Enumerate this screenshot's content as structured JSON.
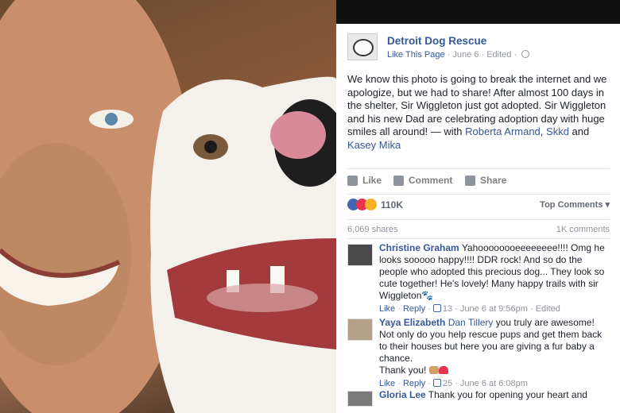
{
  "post": {
    "page_name": "Detroit Dog Rescue",
    "like_page": "Like This Page",
    "date": "June 6",
    "edited": "Edited",
    "text_main": "We know this photo is going to break the internet and we apologize, but we had to share! After almost 100 days in the shelter, Sir Wiggleton just got adopted. Sir Wiggleton and his new Dad are celebrating adoption day with huge smiles all around! — with ",
    "tag1": "Roberta Armand",
    "tag_sep1": ", ",
    "tag2": "Skkd",
    "tag_sep2": " and ",
    "tag3": "Kasey Mika"
  },
  "actions": {
    "like": "Like",
    "comment": "Comment",
    "share": "Share"
  },
  "reactions": {
    "count": "110K",
    "top_comments": "Top Comments ▾"
  },
  "stats": {
    "shares": "6,069 shares",
    "comments": "1K comments"
  },
  "comments": [
    {
      "name": "Christine Graham",
      "text": " Yahoooooooeeeeeeee!!!! Omg he looks sooooo happy!!!! DDR rock! And so do the people who adopted this precious dog... They look so cute together! He's lovely! Many happy trails with sir Wiggleton🐾",
      "like": "Like",
      "reply": "Reply",
      "likes": "13",
      "time": "June 6 at 9:56pm",
      "edited": "Edited"
    },
    {
      "name": "Yaya Elizabeth",
      "tag": "Dan Tillery",
      "text": " you truly are awesome! Not only do you help rescue pups and get them back to their houses but here you are giving a fur baby a chance.",
      "thanks": "Thank you!",
      "like": "Like",
      "reply": "Reply",
      "likes": "25",
      "time": "June 6 at 6:08pm"
    },
    {
      "name": "Gloria Lee",
      "text": " Thank you for opening your heart and"
    }
  ],
  "icons": [
    "globe-icon",
    "like-icon",
    "comment-icon",
    "share-icon",
    "heart-icon"
  ]
}
